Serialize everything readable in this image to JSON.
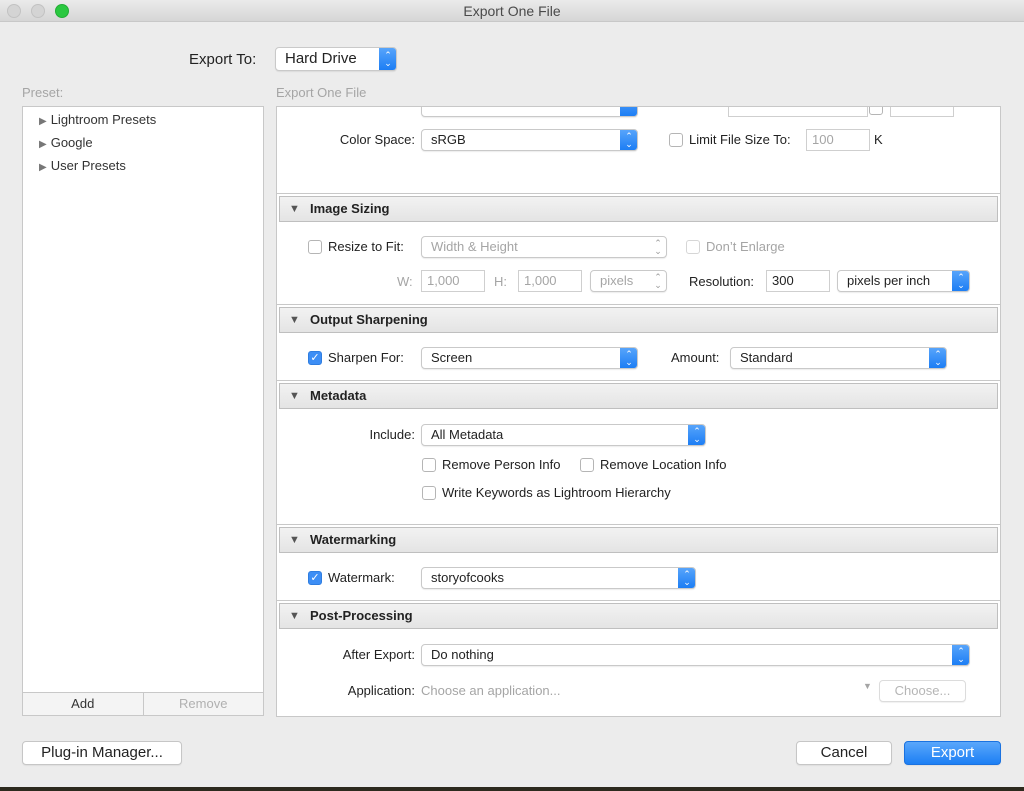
{
  "window": {
    "title": "Export One File"
  },
  "export_to": {
    "label": "Export To:",
    "value": "Hard Drive"
  },
  "preset": {
    "label": "Preset:",
    "items": [
      {
        "label": "Lightroom Presets"
      },
      {
        "label": "Google"
      },
      {
        "label": "User Presets"
      }
    ],
    "add_label": "Add",
    "remove_label": "Remove"
  },
  "settings": {
    "heading": "Export One File",
    "file_settings": {
      "color_space_label": "Color Space:",
      "color_space_value": "sRGB",
      "limit_file_size_label": "Limit File Size To:",
      "limit_file_size_checked": false,
      "limit_file_size_value": "100",
      "limit_file_size_unit": "K"
    },
    "image_sizing": {
      "title": "Image Sizing",
      "resize_label": "Resize to Fit:",
      "resize_checked": false,
      "resize_mode": "Width & Height",
      "dont_enlarge_label": "Don’t Enlarge",
      "dont_enlarge_checked": false,
      "w_label": "W:",
      "w_value": "1,000",
      "h_label": "H:",
      "h_value": "1,000",
      "unit": "pixels",
      "resolution_label": "Resolution:",
      "resolution_value": "300",
      "resolution_unit": "pixels per inch"
    },
    "output_sharpening": {
      "title": "Output Sharpening",
      "sharpen_label": "Sharpen For:",
      "sharpen_checked": true,
      "sharpen_value": "Screen",
      "amount_label": "Amount:",
      "amount_value": "Standard"
    },
    "metadata": {
      "title": "Metadata",
      "include_label": "Include:",
      "include_value": "All Metadata",
      "remove_person_label": "Remove Person Info",
      "remove_location_label": "Remove Location Info",
      "write_keywords_label": "Write Keywords as Lightroom Hierarchy"
    },
    "watermarking": {
      "title": "Watermarking",
      "watermark_label": "Watermark:",
      "watermark_checked": true,
      "watermark_value": "storyofcooks"
    },
    "post_processing": {
      "title": "Post-Processing",
      "after_export_label": "After Export:",
      "after_export_value": "Do nothing",
      "application_label": "Application:",
      "application_placeholder": "Choose an application...",
      "choose_label": "Choose..."
    }
  },
  "footer": {
    "plugin_manager_label": "Plug-in Manager...",
    "cancel_label": "Cancel",
    "export_label": "Export"
  },
  "colors": {
    "accent": "#1c7ff4",
    "window_bg": "#ececec"
  }
}
